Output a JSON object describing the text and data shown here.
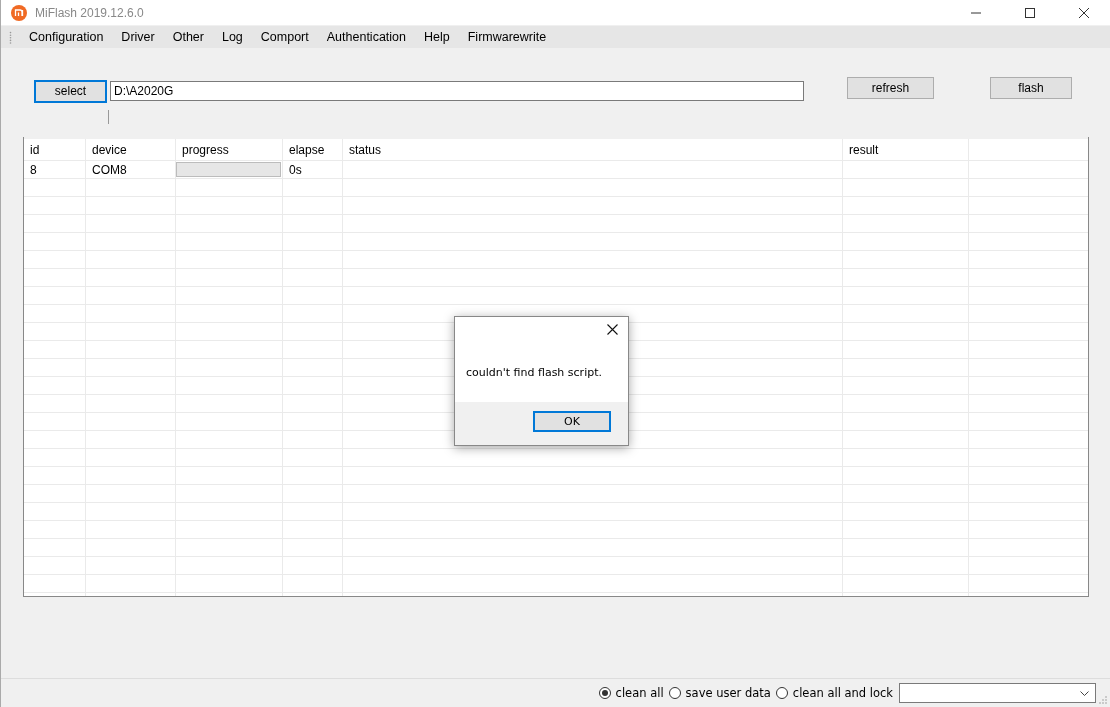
{
  "window": {
    "title": "MiFlash 2019.12.6.0"
  },
  "menu": [
    "Configuration",
    "Driver",
    "Other",
    "Log",
    "Comport",
    "Authentication",
    "Help",
    "Firmwarewrite"
  ],
  "toolbar": {
    "select_button": "select",
    "path": "D:\\A2020G",
    "refresh_button": "refresh",
    "flash_button": "flash"
  },
  "table": {
    "columns": [
      "id",
      "device",
      "progress",
      "elapse",
      "status",
      "result"
    ],
    "rows": [
      {
        "id": "8",
        "device": "COM8",
        "progress": {
          "level": 0
        },
        "elapse": "0s"
      }
    ]
  },
  "dialog": {
    "message": "couldn't find flash script.",
    "ok_button": "OK"
  },
  "options": [
    {
      "label": "clean all",
      "selected": true
    },
    {
      "label": "save user data",
      "selected": false
    },
    {
      "label": "clean all and lock",
      "selected": false
    }
  ]
}
